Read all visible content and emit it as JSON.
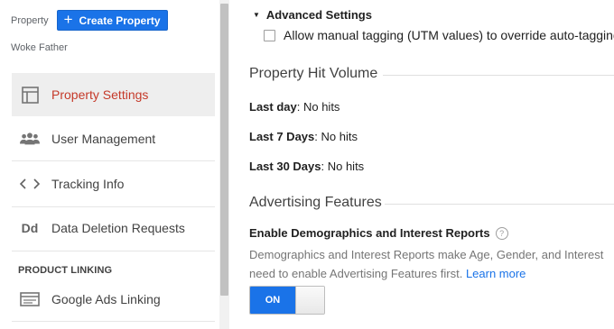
{
  "sidebar": {
    "property_label": "Property",
    "create_button": "Create Property",
    "account_name": "Woke Father",
    "items": [
      {
        "label": "Property Settings",
        "icon": "layout-icon"
      },
      {
        "label": "User Management",
        "icon": "people-icon"
      },
      {
        "label": "Tracking Info",
        "icon": "code-icon"
      },
      {
        "label": "Data Deletion Requests",
        "icon": "dd-icon",
        "icon_text": "Dd"
      }
    ],
    "section_heading": "PRODUCT LINKING",
    "linking_items": [
      {
        "label": "Google Ads Linking",
        "icon": "ads-card-icon"
      }
    ]
  },
  "main": {
    "advanced_settings": "Advanced Settings",
    "manual_tagging": "Allow manual tagging (UTM values) to override auto-tagging",
    "hit_volume": {
      "title": "Property Hit Volume",
      "rows": [
        {
          "label": "Last day",
          "value": ": No hits"
        },
        {
          "label": "Last 7 Days",
          "value": ": No hits"
        },
        {
          "label": "Last 30 Days",
          "value": ": No hits"
        }
      ]
    },
    "advertising": {
      "title": "Advertising Features",
      "demographics_title": "Enable Demographics and Interest Reports",
      "help_glyph": "?",
      "description_line1": "Demographics and Interest Reports make Age, Gender, and Interest",
      "description_line2": "need to enable Advertising Features first.",
      "learn_more": "Learn more",
      "toggle_label": "ON"
    }
  },
  "colors": {
    "primary_blue": "#1a73e8",
    "active_red": "#c53929",
    "active_bg": "#eeeeee"
  }
}
